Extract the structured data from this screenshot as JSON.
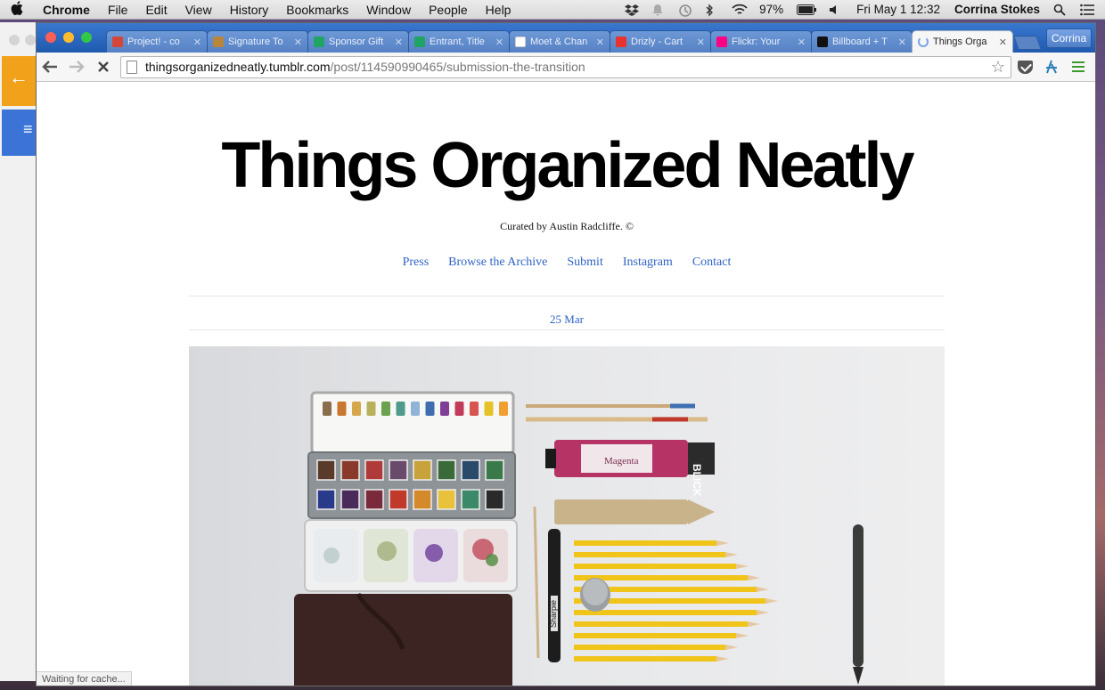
{
  "menubar": {
    "apple_icon": "apple-icon",
    "app": "Chrome",
    "items": [
      "File",
      "Edit",
      "View",
      "History",
      "Bookmarks",
      "Window",
      "People",
      "Help"
    ],
    "battery": "97%",
    "clock": "Fri May 1  12:32",
    "user": "Corrina Stokes"
  },
  "browser": {
    "profile_label": "Corrina",
    "tabs": [
      {
        "label": "Project! - co",
        "favicon": "gmail-icon",
        "color": "#d44638"
      },
      {
        "label": "Signature To",
        "favicon": "tree-icon",
        "color": "#b8863b"
      },
      {
        "label": "Sponsor Gift",
        "favicon": "sheets-icon",
        "color": "#1fa463"
      },
      {
        "label": "Entrant, Title",
        "favicon": "sheets-icon",
        "color": "#1fa463"
      },
      {
        "label": "Moet & Chan",
        "favicon": "doc-icon",
        "color": "#ffffff"
      },
      {
        "label": "Drizly - Cart",
        "favicon": "drizly-icon",
        "color": "#e8322e"
      },
      {
        "label": "Flickr: Your",
        "favicon": "flickr-icon",
        "color": "#ff0084"
      },
      {
        "label": "Billboard + T",
        "favicon": "billboard-icon",
        "color": "#111111"
      },
      {
        "label": "Things Orga",
        "favicon": "loading-spinner",
        "color": "#7aa3e5",
        "active": true
      }
    ],
    "address": {
      "host": "thingsorganizedneatly.tumblr.com",
      "path": "/post/114590990465/submission-the-transition"
    },
    "status_text": "Waiting for cache..."
  },
  "page": {
    "title": "Things Organized Neatly",
    "curated": "Curated by Austin Radcliffe. ©",
    "nav": [
      "Press",
      "Browse the Archive",
      "Submit",
      "Instagram",
      "Contact"
    ],
    "post_date": "25 Mar",
    "photo_alt_labels": {
      "tube_brand": "BLICK",
      "tube_color": "Magenta",
      "marker_brand": "Sharpie"
    }
  }
}
